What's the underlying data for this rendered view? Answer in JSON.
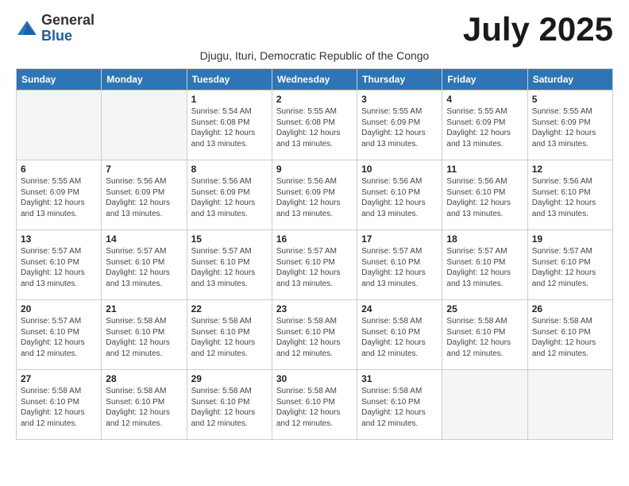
{
  "header": {
    "logo_general": "General",
    "logo_blue": "Blue",
    "month_title": "July 2025",
    "subtitle": "Djugu, Ituri, Democratic Republic of the Congo"
  },
  "days_of_week": [
    "Sunday",
    "Monday",
    "Tuesday",
    "Wednesday",
    "Thursday",
    "Friday",
    "Saturday"
  ],
  "weeks": [
    [
      {
        "day": "",
        "info": ""
      },
      {
        "day": "",
        "info": ""
      },
      {
        "day": "1",
        "info": "Sunrise: 5:54 AM\nSunset: 6:08 PM\nDaylight: 12 hours and 13 minutes."
      },
      {
        "day": "2",
        "info": "Sunrise: 5:55 AM\nSunset: 6:08 PM\nDaylight: 12 hours and 13 minutes."
      },
      {
        "day": "3",
        "info": "Sunrise: 5:55 AM\nSunset: 6:09 PM\nDaylight: 12 hours and 13 minutes."
      },
      {
        "day": "4",
        "info": "Sunrise: 5:55 AM\nSunset: 6:09 PM\nDaylight: 12 hours and 13 minutes."
      },
      {
        "day": "5",
        "info": "Sunrise: 5:55 AM\nSunset: 6:09 PM\nDaylight: 12 hours and 13 minutes."
      }
    ],
    [
      {
        "day": "6",
        "info": "Sunrise: 5:55 AM\nSunset: 6:09 PM\nDaylight: 12 hours and 13 minutes."
      },
      {
        "day": "7",
        "info": "Sunrise: 5:56 AM\nSunset: 6:09 PM\nDaylight: 12 hours and 13 minutes."
      },
      {
        "day": "8",
        "info": "Sunrise: 5:56 AM\nSunset: 6:09 PM\nDaylight: 12 hours and 13 minutes."
      },
      {
        "day": "9",
        "info": "Sunrise: 5:56 AM\nSunset: 6:09 PM\nDaylight: 12 hours and 13 minutes."
      },
      {
        "day": "10",
        "info": "Sunrise: 5:56 AM\nSunset: 6:10 PM\nDaylight: 12 hours and 13 minutes."
      },
      {
        "day": "11",
        "info": "Sunrise: 5:56 AM\nSunset: 6:10 PM\nDaylight: 12 hours and 13 minutes."
      },
      {
        "day": "12",
        "info": "Sunrise: 5:56 AM\nSunset: 6:10 PM\nDaylight: 12 hours and 13 minutes."
      }
    ],
    [
      {
        "day": "13",
        "info": "Sunrise: 5:57 AM\nSunset: 6:10 PM\nDaylight: 12 hours and 13 minutes."
      },
      {
        "day": "14",
        "info": "Sunrise: 5:57 AM\nSunset: 6:10 PM\nDaylight: 12 hours and 13 minutes."
      },
      {
        "day": "15",
        "info": "Sunrise: 5:57 AM\nSunset: 6:10 PM\nDaylight: 12 hours and 13 minutes."
      },
      {
        "day": "16",
        "info": "Sunrise: 5:57 AM\nSunset: 6:10 PM\nDaylight: 12 hours and 13 minutes."
      },
      {
        "day": "17",
        "info": "Sunrise: 5:57 AM\nSunset: 6:10 PM\nDaylight: 12 hours and 13 minutes."
      },
      {
        "day": "18",
        "info": "Sunrise: 5:57 AM\nSunset: 6:10 PM\nDaylight: 12 hours and 13 minutes."
      },
      {
        "day": "19",
        "info": "Sunrise: 5:57 AM\nSunset: 6:10 PM\nDaylight: 12 hours and 12 minutes."
      }
    ],
    [
      {
        "day": "20",
        "info": "Sunrise: 5:57 AM\nSunset: 6:10 PM\nDaylight: 12 hours and 12 minutes."
      },
      {
        "day": "21",
        "info": "Sunrise: 5:58 AM\nSunset: 6:10 PM\nDaylight: 12 hours and 12 minutes."
      },
      {
        "day": "22",
        "info": "Sunrise: 5:58 AM\nSunset: 6:10 PM\nDaylight: 12 hours and 12 minutes."
      },
      {
        "day": "23",
        "info": "Sunrise: 5:58 AM\nSunset: 6:10 PM\nDaylight: 12 hours and 12 minutes."
      },
      {
        "day": "24",
        "info": "Sunrise: 5:58 AM\nSunset: 6:10 PM\nDaylight: 12 hours and 12 minutes."
      },
      {
        "day": "25",
        "info": "Sunrise: 5:58 AM\nSunset: 6:10 PM\nDaylight: 12 hours and 12 minutes."
      },
      {
        "day": "26",
        "info": "Sunrise: 5:58 AM\nSunset: 6:10 PM\nDaylight: 12 hours and 12 minutes."
      }
    ],
    [
      {
        "day": "27",
        "info": "Sunrise: 5:58 AM\nSunset: 6:10 PM\nDaylight: 12 hours and 12 minutes."
      },
      {
        "day": "28",
        "info": "Sunrise: 5:58 AM\nSunset: 6:10 PM\nDaylight: 12 hours and 12 minutes."
      },
      {
        "day": "29",
        "info": "Sunrise: 5:58 AM\nSunset: 6:10 PM\nDaylight: 12 hours and 12 minutes."
      },
      {
        "day": "30",
        "info": "Sunrise: 5:58 AM\nSunset: 6:10 PM\nDaylight: 12 hours and 12 minutes."
      },
      {
        "day": "31",
        "info": "Sunrise: 5:58 AM\nSunset: 6:10 PM\nDaylight: 12 hours and 12 minutes."
      },
      {
        "day": "",
        "info": ""
      },
      {
        "day": "",
        "info": ""
      }
    ]
  ]
}
